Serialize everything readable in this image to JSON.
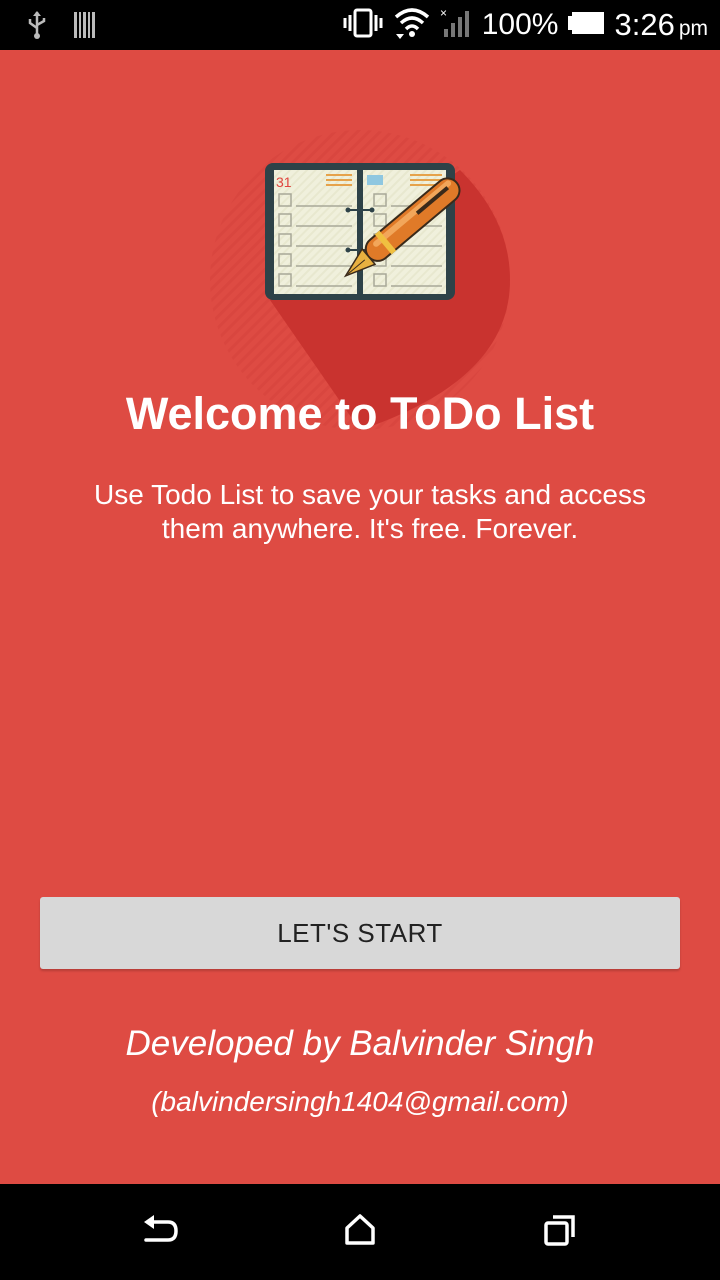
{
  "status_bar": {
    "battery_percent": "100%",
    "time": "3:26",
    "ampm": "pm",
    "icons": [
      "usb-icon",
      "barcode-icon",
      "vibrate-icon",
      "wifi-icon",
      "signal-icon",
      "battery-icon"
    ]
  },
  "welcome": {
    "title": "Welcome to ToDo List",
    "description": "Use Todo List to save your tasks and access them anywhere. It's free. Forever.",
    "calendar_day": "31"
  },
  "start_button": {
    "label": "LET'S START"
  },
  "footer": {
    "developer": "Developed by Balvinder Singh",
    "email": "(balvindersingh1404@gmail.com)"
  },
  "nav": {
    "icons": [
      "back-icon",
      "home-icon",
      "recents-icon"
    ]
  },
  "colors": {
    "background": "#DE4B43",
    "button": "#D8D8D8",
    "shadow": "#C9332F"
  }
}
